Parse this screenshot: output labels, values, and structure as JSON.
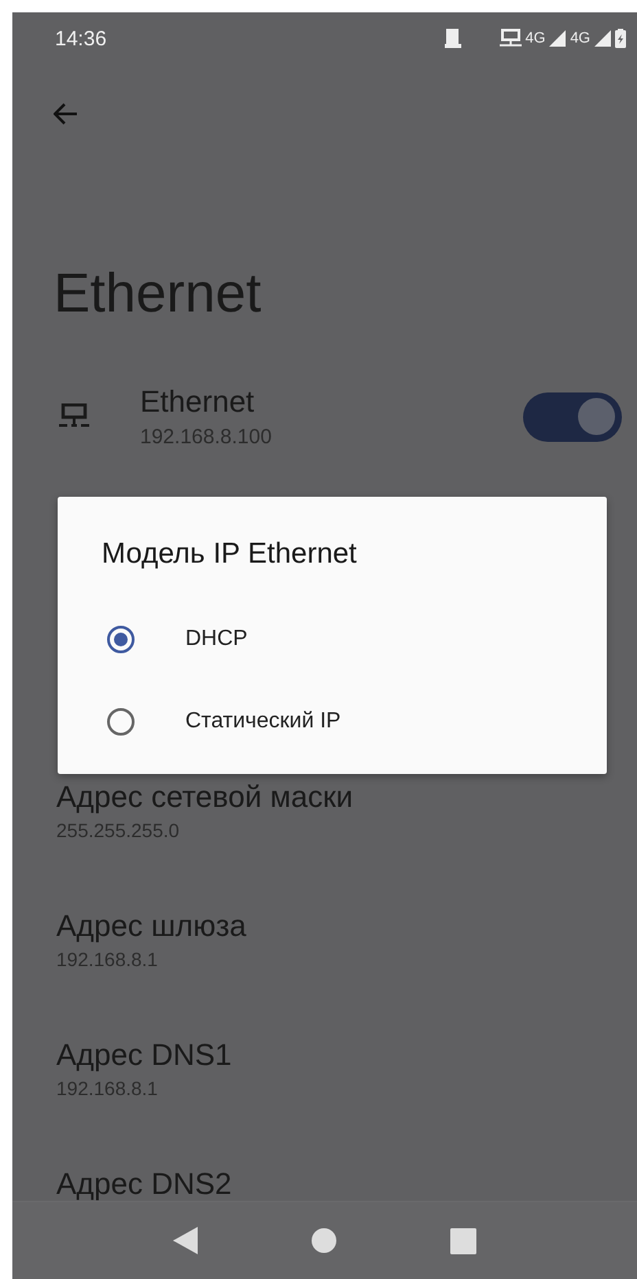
{
  "status_bar": {
    "time": "14:36",
    "network_1": "4G",
    "network_2": "4G"
  },
  "title": "Ethernet",
  "ethernet": {
    "label": "Ethernet",
    "address": "192.168.8.100",
    "on": true
  },
  "dialog": {
    "title": "Модель IP Ethernet",
    "options": [
      {
        "label": "DHCP",
        "selected": true
      },
      {
        "label": "Статический IP",
        "selected": false
      }
    ]
  },
  "settings": [
    {
      "label": "Адрес сетевой маски",
      "value": "255.255.255.0"
    },
    {
      "label": "Адрес шлюза",
      "value": "192.168.8.1"
    },
    {
      "label": "Адрес DNS1",
      "value": "192.168.8.1"
    },
    {
      "label": "Адрес DNS2"
    }
  ]
}
